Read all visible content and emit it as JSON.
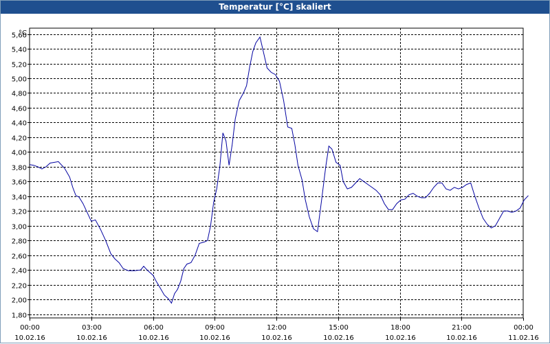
{
  "window": {
    "title": "Temperatur [°C] skaliert"
  },
  "colors": {
    "line": "#0000a0",
    "grid": "#000000",
    "titlebar": "#1f4f8f"
  },
  "chart_data": {
    "type": "line",
    "title": "Temperatur [°C] skaliert",
    "ylabel": "°C",
    "ylim": [
      1.75,
      5.68
    ],
    "xlim_hours": [
      0,
      24
    ],
    "grid": true,
    "y_ticks": [
      "1,80",
      "2,00",
      "2,20",
      "2,40",
      "2,60",
      "2,80",
      "3,00",
      "3,20",
      "3,40",
      "3,60",
      "3,80",
      "4,00",
      "4,20",
      "4,40",
      "4,60",
      "4,80",
      "5,00",
      "5,20",
      "5,40",
      "5,60"
    ],
    "y_tick_values": [
      1.8,
      2.0,
      2.2,
      2.4,
      2.6,
      2.8,
      3.0,
      3.2,
      3.4,
      3.6,
      3.8,
      4.0,
      4.2,
      4.4,
      4.6,
      4.8,
      5.0,
      5.2,
      5.4,
      5.6
    ],
    "x_ticks": [
      {
        "time": "00:00",
        "date": "10.02.16",
        "hour": 0
      },
      {
        "time": "03:00",
        "date": "10.02.16",
        "hour": 3
      },
      {
        "time": "06:00",
        "date": "10.02.16",
        "hour": 6
      },
      {
        "time": "09:00",
        "date": "10.02.16",
        "hour": 9
      },
      {
        "time": "12:00",
        "date": "10.02.16",
        "hour": 12
      },
      {
        "time": "15:00",
        "date": "10.02.16",
        "hour": 15
      },
      {
        "time": "18:00",
        "date": "10.02.16",
        "hour": 18
      },
      {
        "time": "21:00",
        "date": "10.02.16",
        "hour": 21
      },
      {
        "time": "00:00",
        "date": "11.02.16",
        "hour": 24
      }
    ],
    "series": [
      {
        "points": [
          [
            0.0,
            3.83
          ],
          [
            0.2,
            3.82
          ],
          [
            0.4,
            3.8
          ],
          [
            0.6,
            3.77
          ],
          [
            0.8,
            3.8
          ],
          [
            1.0,
            3.85
          ],
          [
            1.4,
            3.87
          ],
          [
            1.7,
            3.78
          ],
          [
            1.95,
            3.66
          ],
          [
            2.1,
            3.52
          ],
          [
            2.25,
            3.41
          ],
          [
            2.4,
            3.39
          ],
          [
            2.6,
            3.3
          ],
          [
            2.8,
            3.18
          ],
          [
            3.0,
            3.06
          ],
          [
            3.2,
            3.08
          ],
          [
            3.45,
            2.95
          ],
          [
            3.7,
            2.8
          ],
          [
            3.95,
            2.62
          ],
          [
            4.15,
            2.55
          ],
          [
            4.35,
            2.5
          ],
          [
            4.55,
            2.42
          ],
          [
            4.8,
            2.39
          ],
          [
            5.1,
            2.39
          ],
          [
            5.4,
            2.4
          ],
          [
            5.55,
            2.45
          ],
          [
            5.75,
            2.39
          ],
          [
            6.0,
            2.33
          ],
          [
            6.15,
            2.25
          ],
          [
            6.3,
            2.18
          ],
          [
            6.55,
            2.06
          ],
          [
            6.75,
            2.01
          ],
          [
            6.9,
            1.95
          ],
          [
            7.05,
            2.08
          ],
          [
            7.2,
            2.14
          ],
          [
            7.35,
            2.25
          ],
          [
            7.5,
            2.42
          ],
          [
            7.65,
            2.48
          ],
          [
            7.85,
            2.5
          ],
          [
            8.05,
            2.6
          ],
          [
            8.25,
            2.76
          ],
          [
            8.5,
            2.78
          ],
          [
            8.65,
            2.8
          ],
          [
            8.8,
            3.0
          ],
          [
            8.95,
            3.32
          ],
          [
            9.1,
            3.5
          ],
          [
            9.25,
            3.8
          ],
          [
            9.4,
            4.26
          ],
          [
            9.55,
            4.15
          ],
          [
            9.7,
            3.82
          ],
          [
            9.85,
            4.1
          ],
          [
            10.0,
            4.45
          ],
          [
            10.2,
            4.7
          ],
          [
            10.4,
            4.8
          ],
          [
            10.55,
            4.9
          ],
          [
            10.7,
            5.15
          ],
          [
            10.85,
            5.36
          ],
          [
            11.0,
            5.48
          ],
          [
            11.2,
            5.56
          ],
          [
            11.35,
            5.38
          ],
          [
            11.55,
            5.14
          ],
          [
            11.75,
            5.08
          ],
          [
            11.95,
            5.05
          ],
          [
            12.15,
            4.96
          ],
          [
            12.35,
            4.7
          ],
          [
            12.55,
            4.34
          ],
          [
            12.75,
            4.32
          ],
          [
            12.9,
            4.1
          ],
          [
            13.05,
            3.82
          ],
          [
            13.25,
            3.62
          ],
          [
            13.4,
            3.36
          ],
          [
            13.6,
            3.12
          ],
          [
            13.8,
            2.96
          ],
          [
            14.0,
            2.92
          ],
          [
            14.2,
            3.35
          ],
          [
            14.4,
            3.8
          ],
          [
            14.55,
            4.08
          ],
          [
            14.7,
            4.04
          ],
          [
            14.9,
            3.86
          ],
          [
            15.1,
            3.82
          ],
          [
            15.25,
            3.6
          ],
          [
            15.45,
            3.5
          ],
          [
            15.65,
            3.52
          ],
          [
            15.85,
            3.58
          ],
          [
            16.05,
            3.64
          ],
          [
            16.25,
            3.6
          ],
          [
            16.45,
            3.56
          ],
          [
            16.65,
            3.52
          ],
          [
            16.85,
            3.48
          ],
          [
            17.05,
            3.42
          ],
          [
            17.25,
            3.3
          ],
          [
            17.45,
            3.22
          ],
          [
            17.65,
            3.22
          ],
          [
            17.85,
            3.3
          ],
          [
            18.05,
            3.35
          ],
          [
            18.25,
            3.36
          ],
          [
            18.45,
            3.42
          ],
          [
            18.65,
            3.44
          ],
          [
            18.85,
            3.4
          ],
          [
            19.05,
            3.38
          ],
          [
            19.25,
            3.38
          ],
          [
            19.45,
            3.44
          ],
          [
            19.65,
            3.52
          ],
          [
            19.85,
            3.58
          ],
          [
            20.05,
            3.58
          ],
          [
            20.25,
            3.5
          ],
          [
            20.45,
            3.48
          ],
          [
            20.65,
            3.52
          ],
          [
            20.85,
            3.5
          ],
          [
            21.05,
            3.52
          ],
          [
            21.25,
            3.56
          ],
          [
            21.45,
            3.58
          ],
          [
            21.65,
            3.4
          ],
          [
            21.85,
            3.24
          ],
          [
            22.05,
            3.1
          ],
          [
            22.25,
            3.02
          ],
          [
            22.45,
            2.97
          ],
          [
            22.65,
            3.0
          ],
          [
            22.85,
            3.1
          ],
          [
            23.05,
            3.2
          ],
          [
            23.25,
            3.2
          ],
          [
            23.45,
            3.18
          ],
          [
            23.65,
            3.2
          ],
          [
            23.85,
            3.24
          ],
          [
            24.05,
            3.35
          ],
          [
            24.25,
            3.41
          ]
        ]
      }
    ]
  }
}
